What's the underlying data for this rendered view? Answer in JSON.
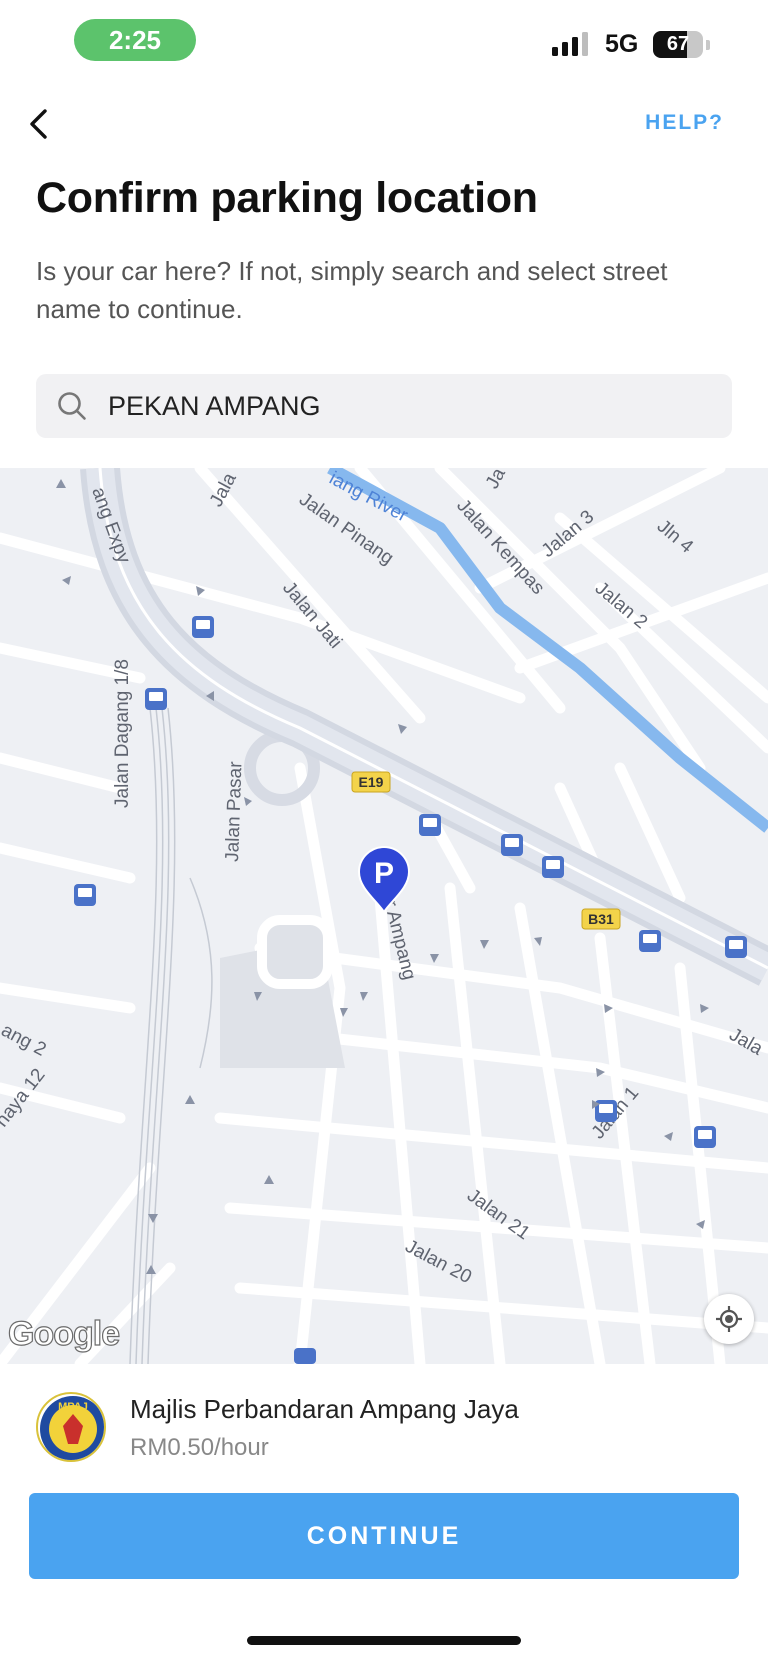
{
  "status_bar": {
    "time": "2:25",
    "network": "5G",
    "battery": "67",
    "battery_level": 0.67,
    "signal_bars": 3
  },
  "header": {
    "back_icon": "chevron-left-icon",
    "help_label": "HELP?",
    "title": "Confirm parking location",
    "subtitle": "Is your car here? If not, simply search and select street name to continue."
  },
  "search": {
    "icon": "search-icon",
    "value": "PEKAN AMPANG"
  },
  "map": {
    "labels": {
      "expressway": "ang Expy",
      "river": "iang River",
      "jalan_pinang": "Jalan Pinang",
      "jalan_kempas": "Jalan Kempas",
      "jalan_3": "Jalan 3",
      "jln_4": "Jln 4",
      "jalan_2": "Jalan 2",
      "jalan_jati": "Jalan Jati",
      "jalan_dagang": "Jalan Dagang 1/8",
      "jalan_pasar": "Jalan Pasar",
      "besar_ampang": "Besar Ampang",
      "jalan_1": "Jalan 1",
      "jalan_21": "Jalan 21",
      "jalan_20": "Jalan 20",
      "left_edge_1": "ang 2",
      "left_edge_2": "naya 12",
      "right_edge": "Jala",
      "top_left": "Jala",
      "top_mid": "Ja"
    },
    "route_shields": [
      "E19",
      "B31"
    ],
    "pin_letter": "P",
    "attribution": "Google",
    "locate_icon": "locate-icon"
  },
  "operator": {
    "logo_text": "MPAJ",
    "name": "Majlis Perbandaran Ampang Jaya",
    "rate": "RM0.50/hour"
  },
  "continue_label": "CONTINUE",
  "colors": {
    "accent": "#4aa3f0",
    "status_pill": "#5cc36c",
    "pin": "#2f47d6",
    "river": "#86b8ee"
  }
}
